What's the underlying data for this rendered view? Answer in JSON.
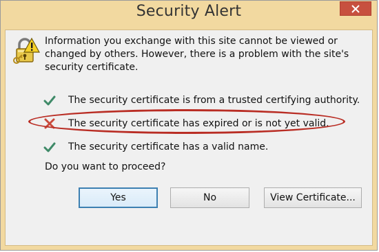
{
  "window": {
    "title": "Security Alert",
    "close_icon": "close-icon",
    "frame_color": "#f2d9a0",
    "close_color": "#c7503f"
  },
  "dialog": {
    "icon": "lock-icon",
    "message": "Information you exchange with this site cannot be viewed or changed by others. However, there is a problem with the site's security certificate.",
    "checks": [
      {
        "status": "ok",
        "icon": "checkmark-icon",
        "text": "The security certificate is from a trusted certifying authority."
      },
      {
        "status": "error",
        "icon": "cross-icon",
        "text": "The security certificate has expired or is not yet valid."
      },
      {
        "status": "ok",
        "icon": "checkmark-icon",
        "text": "The security certificate has a valid name."
      }
    ],
    "question": "Do you want to proceed?",
    "highlight_color": "#b92d24"
  },
  "buttons": {
    "yes": "Yes",
    "no": "No",
    "view_certificate": "View Certificate..."
  }
}
